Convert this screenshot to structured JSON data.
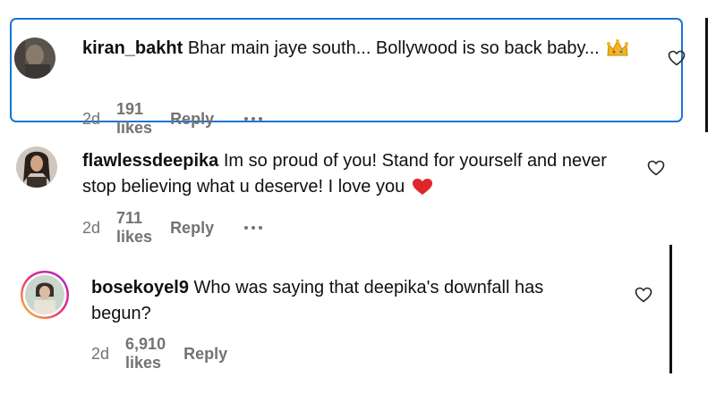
{
  "comments": [
    {
      "username": "kiran_bakht",
      "text": "Bhar main jaye south... Bollywood is so back baby...",
      "emoji": "crown-icon",
      "time": "2d",
      "likes": "191 likes",
      "reply": "Reply",
      "has_more": true,
      "focused": true
    },
    {
      "username": "flawlessdeepika",
      "text": "Im so proud of you! Stand for yourself and never stop believing what u deserve! I love you",
      "emoji": "red-heart-icon",
      "time": "2d",
      "likes": "711 likes",
      "reply": "Reply",
      "has_more": true
    },
    {
      "username": "bosekoyel9",
      "text": "Who was saying that deepika's downfall has begun?",
      "time": "2d",
      "likes": "6,910 likes",
      "reply": "Reply",
      "has_story_ring": true
    }
  ],
  "colors": {
    "focus_ring": "#1a73d9",
    "meta_text": "#737373",
    "story_ring_start": "#f9ce34",
    "story_ring_end": "#ee2a7b"
  }
}
